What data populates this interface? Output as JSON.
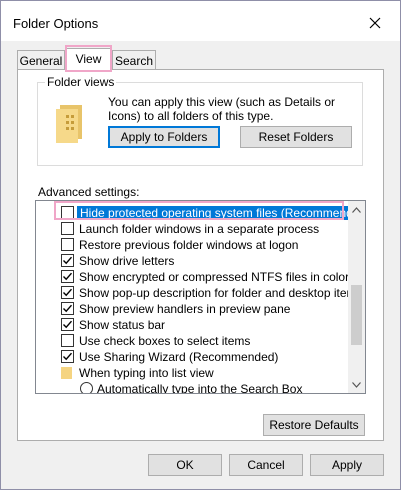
{
  "window": {
    "title": "Folder Options"
  },
  "tabs": [
    {
      "label": "General"
    },
    {
      "label": "View"
    },
    {
      "label": "Search"
    }
  ],
  "folder_views": {
    "legend": "Folder views",
    "description": "You can apply this view (such as Details or Icons) to all folders of this type.",
    "apply_button": "Apply to Folders",
    "reset_button": "Reset Folders"
  },
  "advanced": {
    "label": "Advanced settings:",
    "items": [
      {
        "label": "Hide protected operating system files (Recommended)",
        "checked": false,
        "type": "checkbox",
        "selected": true
      },
      {
        "label": "Launch folder windows in a separate process",
        "checked": false,
        "type": "checkbox"
      },
      {
        "label": "Restore previous folder windows at logon",
        "checked": false,
        "type": "checkbox"
      },
      {
        "label": "Show drive letters",
        "checked": true,
        "type": "checkbox"
      },
      {
        "label": "Show encrypted or compressed NTFS files in color",
        "checked": true,
        "type": "checkbox"
      },
      {
        "label": "Show pop-up description for folder and desktop items",
        "checked": true,
        "type": "checkbox"
      },
      {
        "label": "Show preview handlers in preview pane",
        "checked": true,
        "type": "checkbox"
      },
      {
        "label": "Show status bar",
        "checked": true,
        "type": "checkbox"
      },
      {
        "label": "Use check boxes to select items",
        "checked": false,
        "type": "checkbox"
      },
      {
        "label": "Use Sharing Wizard (Recommended)",
        "checked": true,
        "type": "checkbox"
      },
      {
        "label": "When typing into list view",
        "type": "folder"
      },
      {
        "label": "Automatically type into the Search Box",
        "type": "radio",
        "checked": false
      }
    ],
    "restore_button": "Restore Defaults"
  },
  "footer": {
    "ok": "OK",
    "cancel": "Cancel",
    "apply": "Apply"
  },
  "colors": {
    "selection": "#0078d7",
    "highlight_outline": "#f0a6c8",
    "primary_border": "#0078d7"
  }
}
